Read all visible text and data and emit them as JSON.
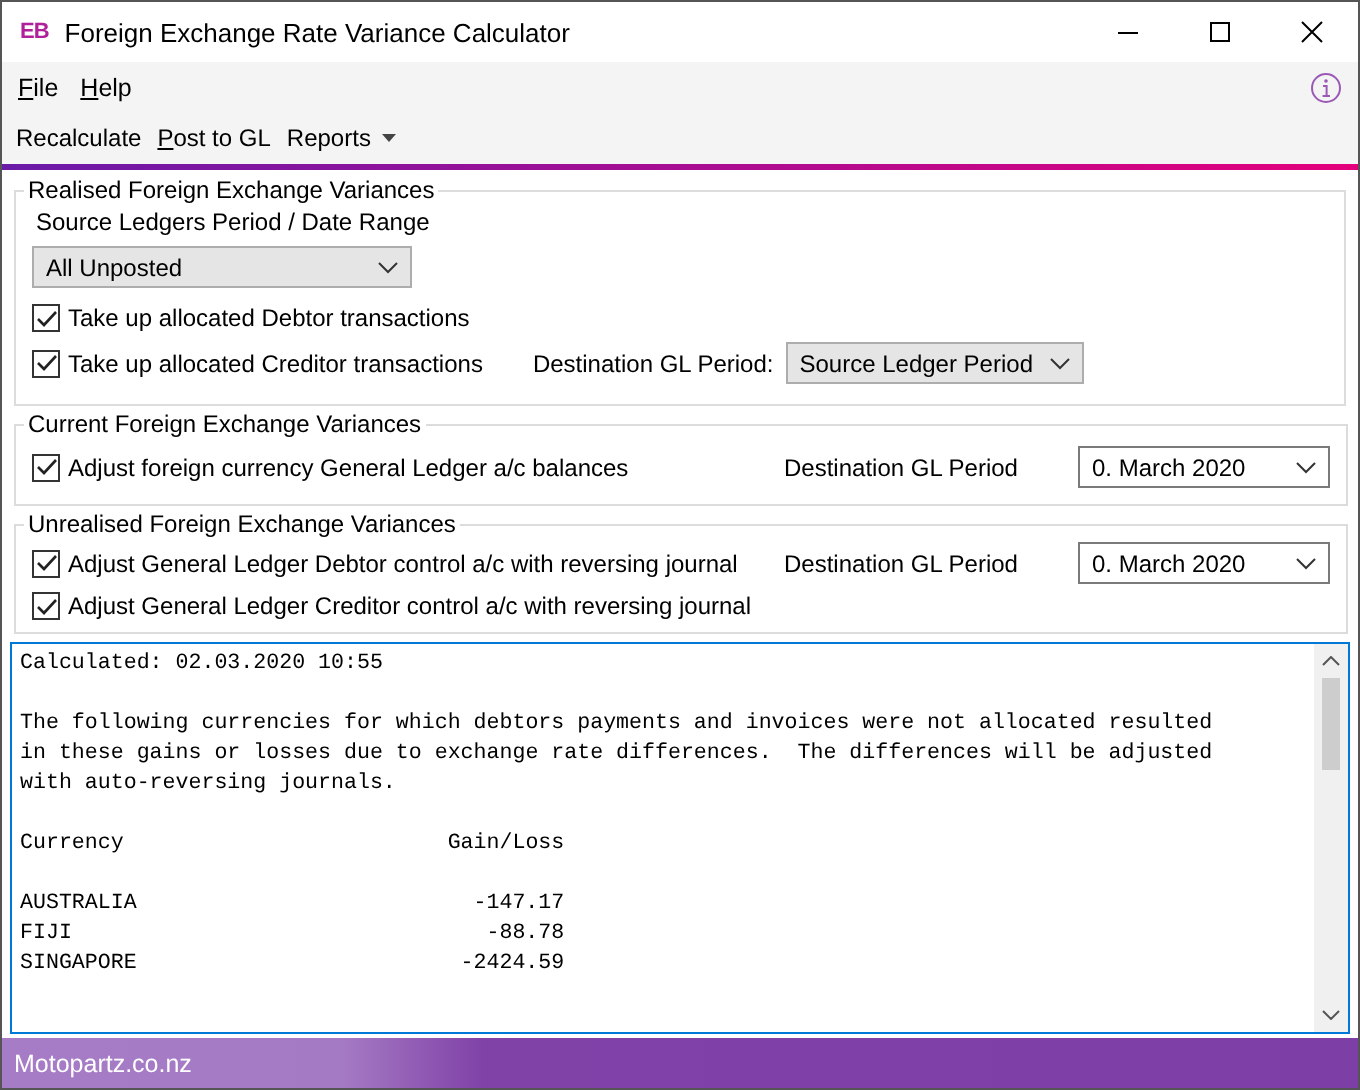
{
  "window": {
    "title": "Foreign Exchange Rate Variance Calculator",
    "logo": "EB"
  },
  "menu": [
    {
      "label": "File",
      "underline_first": true
    },
    {
      "label": "Help",
      "underline_first": true
    }
  ],
  "toolbar": [
    {
      "label": "Recalculate",
      "underline_first": false,
      "dropdown": false
    },
    {
      "label": "Post to GL",
      "underline_first": true,
      "dropdown": false
    },
    {
      "label": "Reports",
      "underline_first": false,
      "dropdown": true
    }
  ],
  "realised": {
    "title": "Realised Foreign Exchange Variances",
    "range_label": "Source Ledgers Period / Date Range",
    "range_value": "All Unposted",
    "debtor": {
      "label": "Take up allocated Debtor transactions",
      "checked": true
    },
    "creditor": {
      "label": "Take up allocated Creditor transactions",
      "checked": true
    },
    "dest_label": "Destination GL Period:",
    "dest_value": "Source Ledger Period"
  },
  "current": {
    "title": "Current Foreign Exchange Variances",
    "adjust": {
      "label": "Adjust foreign currency General Ledger a/c balances",
      "checked": true
    },
    "dest_label": "Destination GL Period",
    "dest_value": "0. March 2020"
  },
  "unrealised": {
    "title": "Unrealised Foreign Exchange Variances",
    "debtor": {
      "label": "Adjust General Ledger Debtor control a/c with reversing journal",
      "checked": true
    },
    "creditor": {
      "label": "Adjust General Ledger Creditor control a/c with reversing journal",
      "checked": true
    },
    "dest_label": "Destination GL Period",
    "dest_value": "0. March 2020"
  },
  "log": {
    "calculated": "Calculated: 02.03.2020 10:55",
    "paragraph": "The following currencies for which debtors payments and invoices were not allocated resulted in these gains or losses due to exchange rate differences.  The differences will be adjusted with auto-reversing journals.",
    "columns": [
      "Currency",
      "Gain/Loss"
    ],
    "rows": [
      {
        "currency": "AUSTRALIA",
        "amount": "-147.17"
      },
      {
        "currency": "FIJI",
        "amount": "-88.78"
      },
      {
        "currency": "SINGAPORE",
        "amount": "-2424.59"
      }
    ]
  },
  "status_bar": {
    "company": "Motopartz.co.nz"
  }
}
